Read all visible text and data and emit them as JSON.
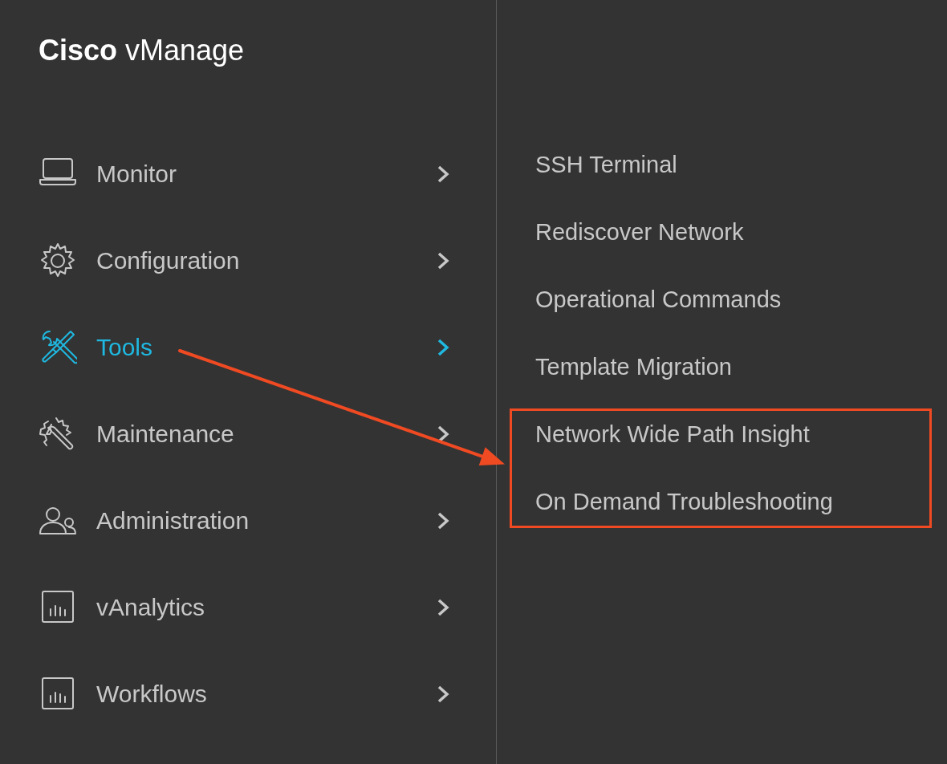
{
  "logo": {
    "brand": "Cisco",
    "product": "vManage"
  },
  "menu": [
    {
      "label": "Monitor",
      "selected": false
    },
    {
      "label": "Configuration",
      "selected": false
    },
    {
      "label": "Tools",
      "selected": true
    },
    {
      "label": "Maintenance",
      "selected": false
    },
    {
      "label": "Administration",
      "selected": false
    },
    {
      "label": "vAnalytics",
      "selected": false
    },
    {
      "label": "Workflows",
      "selected": false
    }
  ],
  "submenu": [
    {
      "label": "SSH Terminal",
      "highlighted": false
    },
    {
      "label": "Rediscover Network",
      "highlighted": false
    },
    {
      "label": "Operational Commands",
      "highlighted": false
    },
    {
      "label": "Template Migration",
      "highlighted": false
    },
    {
      "label": "Network Wide Path Insight",
      "highlighted": true
    },
    {
      "label": "On Demand Troubleshooting",
      "highlighted": true
    }
  ]
}
